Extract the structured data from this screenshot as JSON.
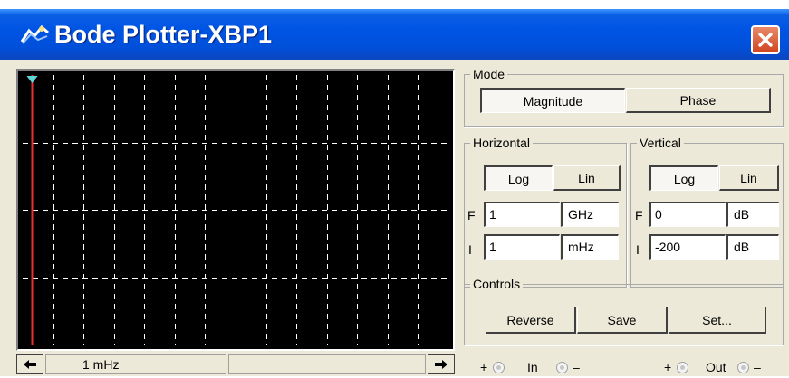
{
  "window": {
    "title": "Bode Plotter-XBP1",
    "icons": {
      "app": "bode-plotter-icon",
      "close": "close-icon"
    }
  },
  "mode": {
    "legend": "Mode",
    "magnitude_label": "Magnitude",
    "phase_label": "Phase",
    "selected": "Magnitude"
  },
  "horizontal": {
    "legend": "Horizontal",
    "log_label": "Log",
    "lin_label": "Lin",
    "selected": "Log",
    "final": {
      "label": "F",
      "value": "1",
      "unit": "GHz"
    },
    "initial": {
      "label": "I",
      "value": "1",
      "unit": "mHz"
    }
  },
  "vertical": {
    "legend": "Vertical",
    "log_label": "Log",
    "lin_label": "Lin",
    "selected": "Log",
    "final": {
      "label": "F",
      "value": "0",
      "unit": "dB"
    },
    "initial": {
      "label": "I",
      "value": "-200",
      "unit": "dB"
    }
  },
  "controls": {
    "legend": "Controls",
    "reverse_label": "Reverse",
    "save_label": "Save",
    "set_label": "Set..."
  },
  "plot": {
    "background": "#000000",
    "grid_color": "#ffffff",
    "cursor_color": "#e83030",
    "cursor_marker_color": "#5fd7d7",
    "cursor_position": 0
  },
  "status": {
    "readout": "1 mHz",
    "left_icon": "left-arrow-icon",
    "right_icon": "right-arrow-icon"
  },
  "terminals": {
    "in_label": "In",
    "out_label": "Out",
    "plus": "+",
    "minus": "–"
  },
  "colors": {
    "titlebar": "#0054e3",
    "window_bg": "#ece9d8",
    "close_button": "#d65535"
  }
}
